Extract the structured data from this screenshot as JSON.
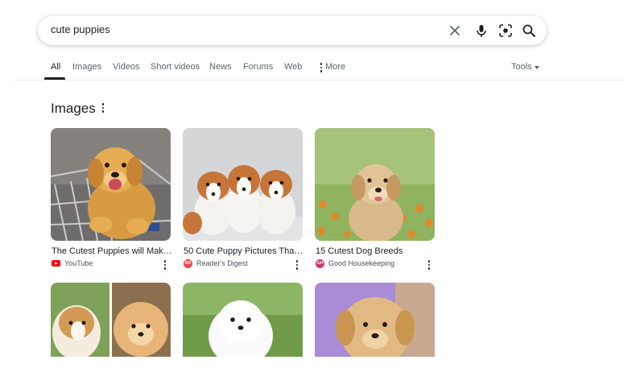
{
  "search": {
    "query": "cute puppies"
  },
  "tabs": [
    {
      "label": "All",
      "active": true
    },
    {
      "label": "Images"
    },
    {
      "label": "Videos"
    },
    {
      "label": "Short videos"
    },
    {
      "label": "News"
    },
    {
      "label": "Forums"
    },
    {
      "label": "Web"
    },
    {
      "label": "More"
    }
  ],
  "tools_label": "Tools",
  "section": {
    "title": "Images"
  },
  "images": [
    {
      "title": "The Cutest Puppies will Make...",
      "source": "YouTube",
      "source_icon": "youtube-icon"
    },
    {
      "title": "50 Cute Puppy Pictures That ...",
      "source": "Reader's Digest",
      "source_icon": "readers-digest-icon",
      "source_icon_text": "RD"
    },
    {
      "title": "15 Cutest Dog Breeds",
      "source": "Good Housekeeping",
      "source_icon": "good-housekeeping-icon",
      "source_icon_text": "GH"
    }
  ],
  "colors": {
    "accent": "#202124",
    "youtube": "#ff0000",
    "readers_digest": "#e8434c",
    "good_housekeeping": "#d6326b"
  }
}
